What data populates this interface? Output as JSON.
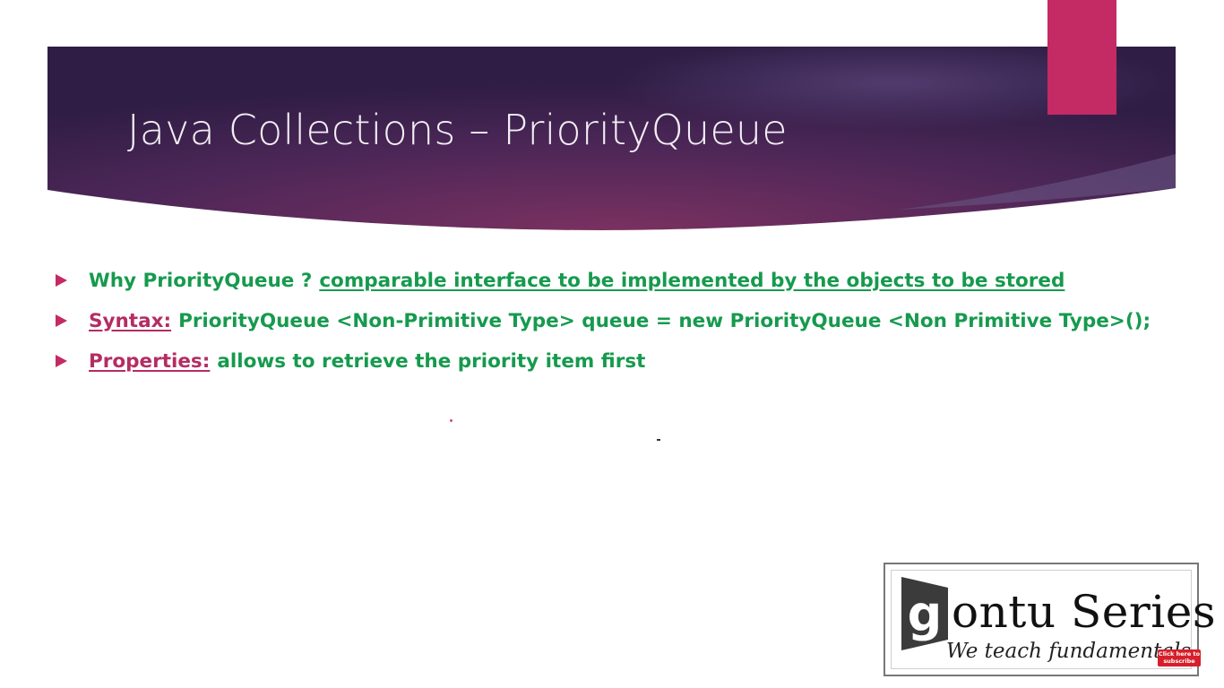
{
  "slide": {
    "title": "Java Collections – PriorityQueue",
    "bullets": [
      {
        "lead": "Why PriorityQueue ?",
        "rest": "comparable interface to be implemented by the objects to be stored"
      },
      {
        "lead": "Syntax:",
        "rest": "PriorityQueue <Non-Primitive Type> queue = new PriorityQueue <Non Primitive Type>();"
      },
      {
        "lead": "Properties:",
        "rest": "allows to retrieve the priority item first"
      }
    ]
  },
  "logo": {
    "main": "ontu Series",
    "tagline": "We teach fundamentals"
  },
  "subscribe": {
    "line1": "Click here to",
    "line2": "subscribe"
  },
  "colors": {
    "banner_dark": "#3c2255",
    "banner_mid": "#72305f",
    "accent": "#c42a63",
    "bullet_text": "#169a4e",
    "lead_pink": "#b42d62",
    "icons": {
      "bullet": "triangle-right-icon"
    }
  }
}
